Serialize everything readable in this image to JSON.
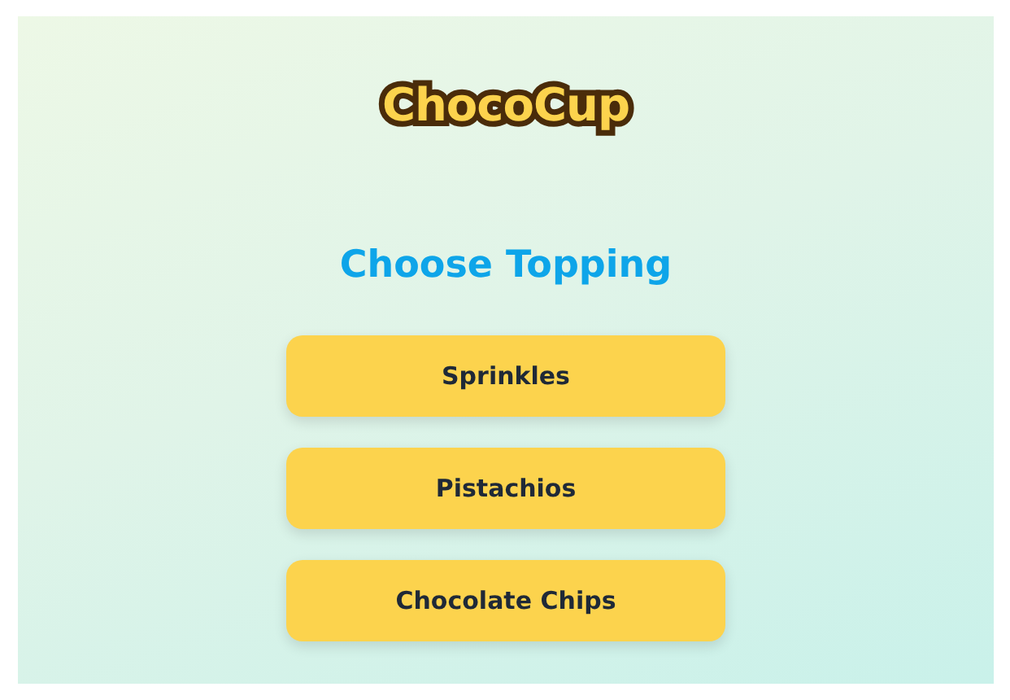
{
  "logo": {
    "text": "ChocoCup"
  },
  "heading": "Choose Topping",
  "options": [
    {
      "label": "Sprinkles"
    },
    {
      "label": "Pistachios"
    },
    {
      "label": "Chocolate Chips"
    }
  ]
}
